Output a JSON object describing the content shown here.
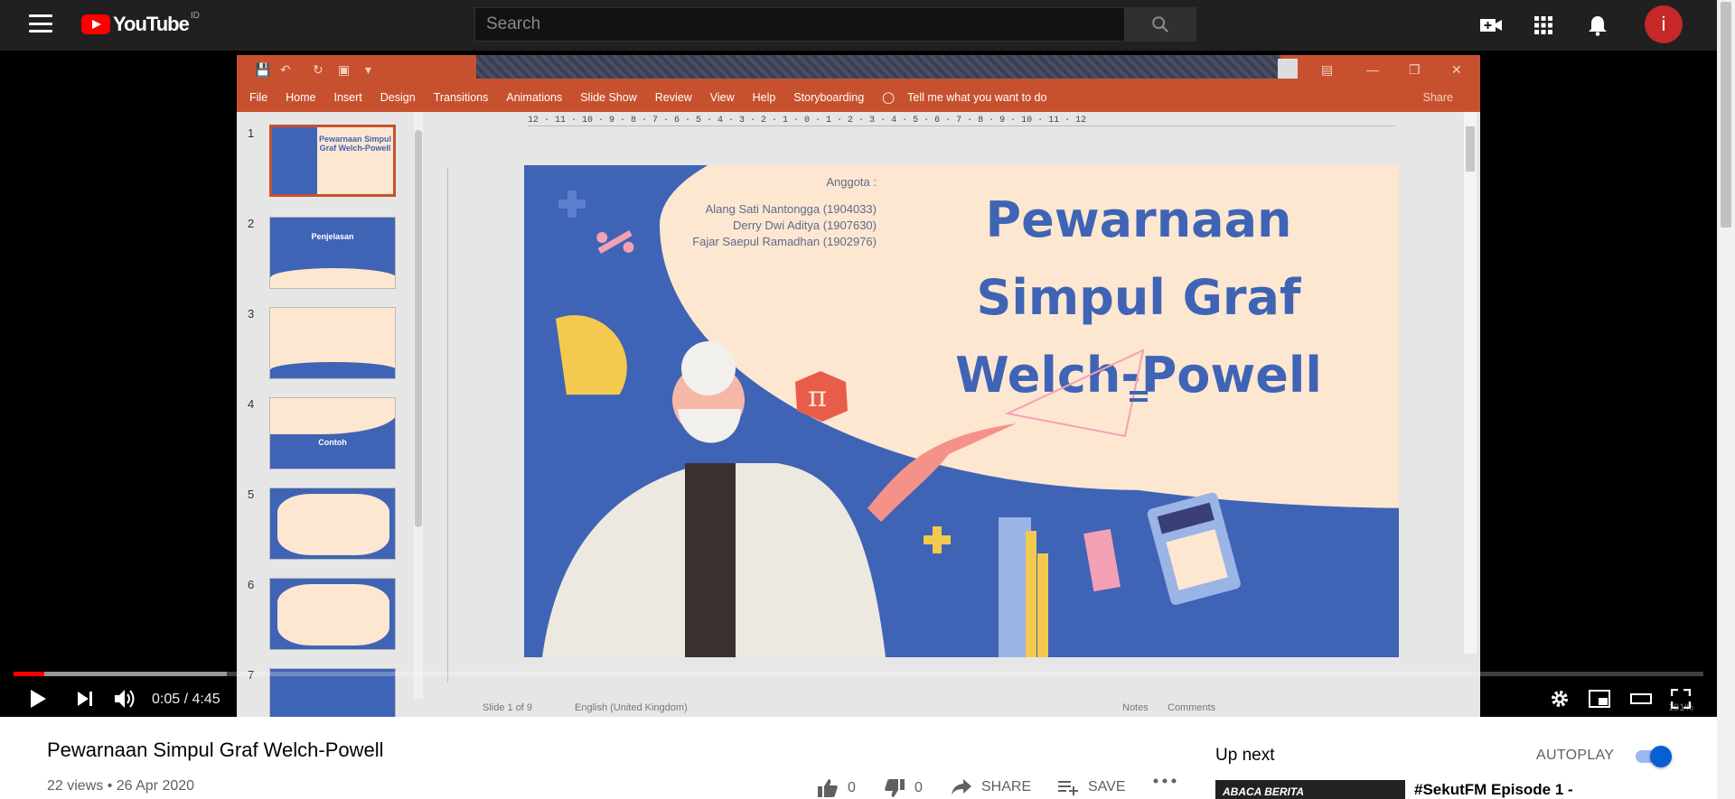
{
  "masthead": {
    "logo_text": "YouTube",
    "country_code": "ID",
    "search_placeholder": "Search",
    "avatar_letter": "i"
  },
  "presentation": {
    "ribbon_tabs": [
      "File",
      "Home",
      "Insert",
      "Design",
      "Transitions",
      "Animations",
      "Slide Show",
      "Review",
      "View",
      "Help",
      "Storyboarding"
    ],
    "tell_me": "Tell me what you want to do",
    "share": "Share",
    "thumbnails": [
      {
        "num": "1",
        "label": "Pewarnaan Simpul Graf Welch-Powell"
      },
      {
        "num": "2",
        "label": "Penjelasan"
      },
      {
        "num": "3",
        "label": ""
      },
      {
        "num": "4",
        "label": "Contoh"
      },
      {
        "num": "5",
        "label": ""
      },
      {
        "num": "6",
        "label": ""
      },
      {
        "num": "7",
        "label": ""
      }
    ],
    "ruler": "12 · 11 · 10 · 9 · 8 · 7 · 6 · 5 · 4 · 3 · 2 · 1 · 0 · 1 · 2 · 3 · 4 · 5 · 6 · 7 · 8 · 9 · 10 · 11 · 12",
    "slide": {
      "title_line1": "Pewarnaan",
      "title_line2": "Simpul Graf",
      "title_line3": "Welch-Powell",
      "members_heading": "Anggota :",
      "members": [
        "Alang Sati Nantongga (1904033)",
        "Derry Dwi Aditya (1907630)",
        "Fajar Saepul Ramadhan (1902976)"
      ],
      "pi_symbol": "π"
    },
    "statusbar": {
      "slide_count": "Slide 1 of 9",
      "language": "English (United Kingdom)",
      "notes": "Notes",
      "comments": "Comments",
      "zoom": "101%"
    }
  },
  "player": {
    "current_time": "0:05",
    "duration": "4:45",
    "time_display": "0:05 / 4:45",
    "played_fraction": 0.018,
    "buffered_fraction": 0.126
  },
  "video": {
    "title": "Pewarnaan Simpul Graf Welch-Powell",
    "meta": "22 views • 26 Apr 2020",
    "likes": "0",
    "dislikes": "0",
    "share_label": "SHARE",
    "save_label": "SAVE"
  },
  "sidebar": {
    "up_next": "Up next",
    "autoplay": "AUTOPLAY",
    "autoplay_on": true,
    "rec_thumb_text": "ABACA BERITA",
    "rec_title": "#SekutFM Episode 1 -"
  },
  "colors": {
    "youtube_red": "#ff0000",
    "ppt_orange": "#c7512e",
    "slide_blue": "#3f64b5",
    "slide_cream": "#fde7d1"
  }
}
